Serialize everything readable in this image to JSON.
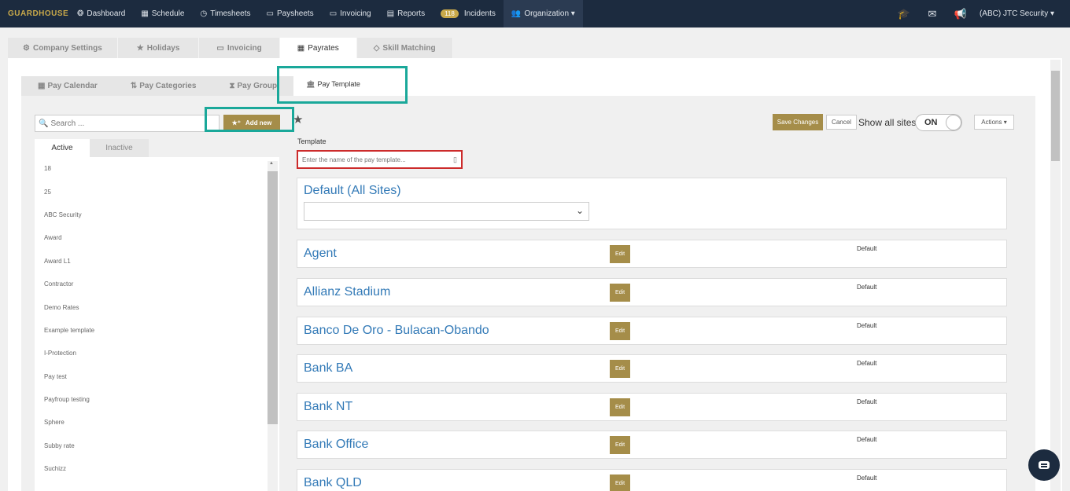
{
  "nav": {
    "logo": "GUARDHOUSE",
    "items": [
      {
        "icon": "dashboard-icon",
        "glyph": "❂",
        "label": "Dashboard"
      },
      {
        "icon": "calendar-icon",
        "glyph": "▦",
        "label": "Schedule"
      },
      {
        "icon": "clock-icon",
        "glyph": "◷",
        "label": "Timesheets"
      },
      {
        "icon": "money-icon",
        "glyph": "▭",
        "label": "Paysheets"
      },
      {
        "icon": "invoice-icon",
        "glyph": "▭",
        "label": "Invoicing"
      },
      {
        "icon": "report-icon",
        "glyph": "▤",
        "label": "Reports"
      }
    ],
    "incidents_count": "118",
    "incidents_label": "Incidents",
    "organization_label": "Organization ▾",
    "org_name": "(ABC) JTC Security ▾"
  },
  "tabs": [
    {
      "label": "Company Settings",
      "glyph": "⚙"
    },
    {
      "label": "Holidays",
      "glyph": "★"
    },
    {
      "label": "Invoicing",
      "glyph": "▭"
    },
    {
      "label": "Payrates",
      "glyph": "▦"
    },
    {
      "label": "Skill Matching",
      "glyph": "◇"
    }
  ],
  "subtabs": [
    {
      "label": "Pay Calendar",
      "glyph": "▦"
    },
    {
      "label": "Pay Categories",
      "glyph": "⇅"
    },
    {
      "label": "Pay Group",
      "glyph": "⧗"
    },
    {
      "label": "Pay Template",
      "glyph": "🏛"
    }
  ],
  "left": {
    "search_placeholder": "Search ...",
    "add_new_label": "Add new",
    "tab_active": "Active",
    "tab_inactive": "Inactive",
    "items": [
      "18",
      "25",
      "ABC Security",
      "Award",
      "Award L1",
      "Contractor",
      "Demo Rates",
      "Example template",
      "I-Protection",
      "Pay test",
      "Payfroup testing",
      "Sphere",
      "Subby rate",
      "Suchizz"
    ]
  },
  "right": {
    "save_label": "Save Changes",
    "cancel_label": "Cancel",
    "show_all_sites_label": "Show all sites",
    "toggle_label": "ON",
    "actions_label": "Actions ▾",
    "template_label": "Template",
    "template_placeholder": "Enter the name of the pay template...",
    "default_title": "Default (All Sites)",
    "edit_label": "Edit",
    "default_text": "Default",
    "sites": [
      "Agent",
      "Allianz Stadium",
      "Banco De Oro - Bulacan-Obando",
      "Bank BA",
      "Bank NT",
      "Bank Office",
      "Bank QLD"
    ]
  },
  "colors": {
    "nav_bg": "#1c2b3f",
    "accent_gold": "#a58d49",
    "highlight_teal": "#1aa89a",
    "link_blue": "#337ab7",
    "error_red": "#cc2b2b"
  }
}
